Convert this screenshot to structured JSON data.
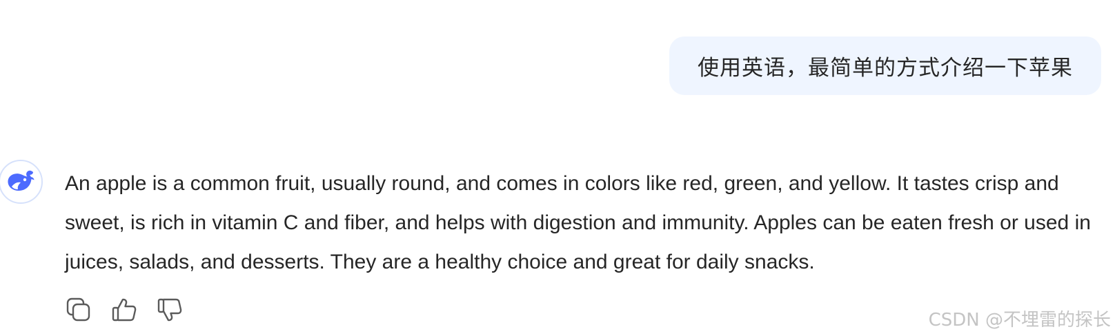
{
  "user_message": {
    "text": "使用英语，最简单的方式介绍一下苹果"
  },
  "assistant": {
    "avatar_icon": "deepseek-whale-icon",
    "brand_color": "#4d6bfe",
    "response_text": "An apple is a common fruit, usually round, and comes in colors like red, green, and yellow. It tastes crisp and sweet, is rich in vitamin C and fiber, and helps with digestion and immunity. Apples can be eaten fresh or used in juices, salads, and desserts. They are a healthy choice and great for daily snacks."
  },
  "actions": [
    {
      "icon": "copy-icon"
    },
    {
      "icon": "thumbs-up-icon"
    },
    {
      "icon": "thumbs-down-icon"
    }
  ],
  "watermark": {
    "text": "CSDN @不埋雷的探长"
  }
}
